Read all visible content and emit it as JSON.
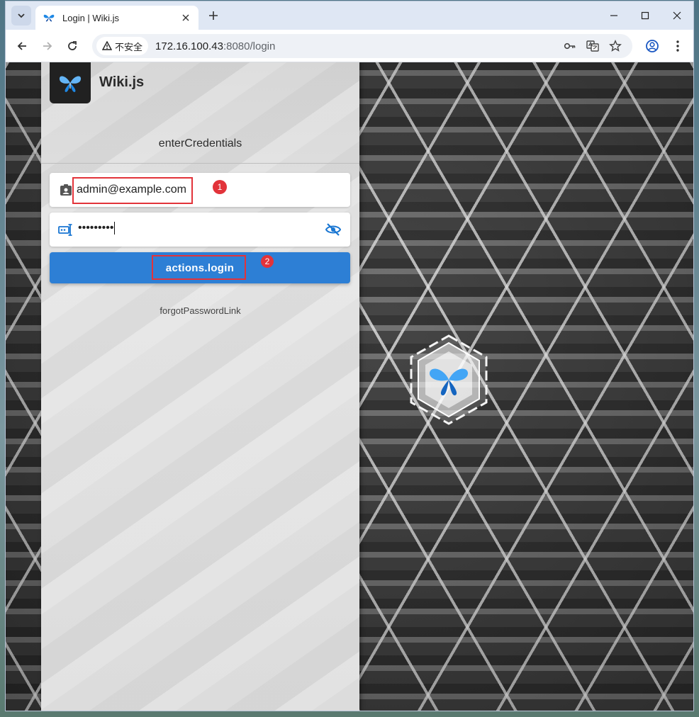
{
  "browser": {
    "tab_title": "Login | Wiki.js",
    "security_label": "不安全",
    "url_host": "172.16.100.43",
    "url_rest": ":8080/login"
  },
  "login": {
    "brand_name": "Wiki.js",
    "subtitle": "enterCredentials",
    "email_value": "admin@example.com",
    "password_mask": "•••••••••",
    "login_button_label": "actions.login",
    "forgot_link": "forgotPasswordLink"
  },
  "annotations": {
    "badge_1": "1",
    "badge_2": "2",
    "highlight_color": "#e2333a"
  },
  "colors": {
    "primary_button": "#2d7fd5",
    "field_icon": "#1976d2"
  }
}
